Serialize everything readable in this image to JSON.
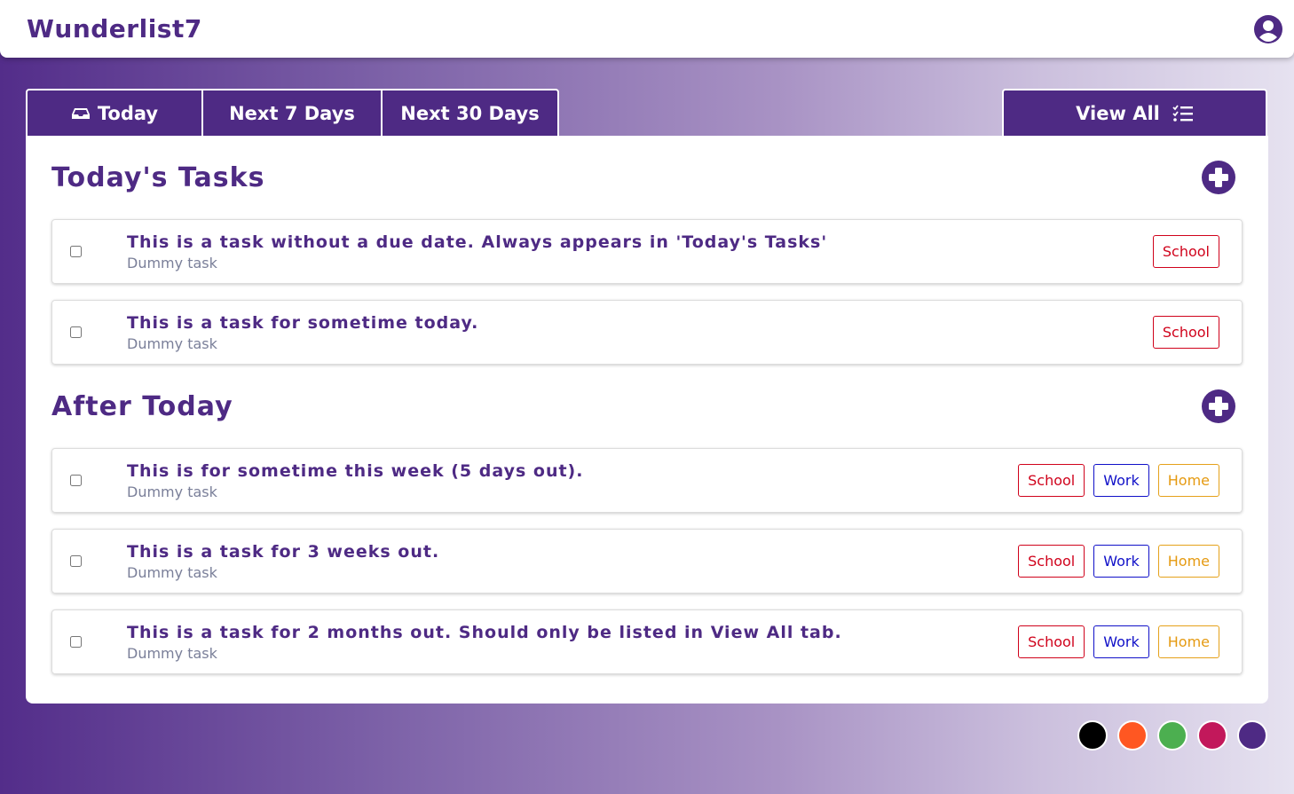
{
  "app": {
    "title": "Wunderlist7"
  },
  "tabs": {
    "today": "Today",
    "next7": "Next 7 Days",
    "next30": "Next 30 Days",
    "view_all": "View All"
  },
  "sections": [
    {
      "title": "Today's Tasks",
      "tasks": [
        {
          "title": "This is a task without a due date. Always appears in 'Today's Tasks'",
          "desc": "Dummy task",
          "checked": false,
          "tags": [
            "School"
          ]
        },
        {
          "title": "This is a task for sometime today.",
          "desc": "Dummy task",
          "checked": false,
          "tags": [
            "School"
          ]
        }
      ]
    },
    {
      "title": "After Today",
      "tasks": [
        {
          "title": "This is for sometime this week (5 days out).",
          "desc": "Dummy task",
          "checked": false,
          "tags": [
            "School",
            "Work",
            "Home"
          ]
        },
        {
          "title": "This is a task for 3 weeks out.",
          "desc": "Dummy task",
          "checked": false,
          "tags": [
            "School",
            "Work",
            "Home"
          ]
        },
        {
          "title": "This is a task for 2 months out. Should only be listed in View All tab.",
          "desc": "Dummy task",
          "checked": false,
          "tags": [
            "School",
            "Work",
            "Home"
          ]
        }
      ]
    }
  ],
  "tag_colors": {
    "School": "#d0021b",
    "Work": "#1010c8",
    "Home": "#e59a11"
  },
  "theme": {
    "accent": "#4e2a84",
    "swatches": [
      "#000000",
      "#ff5722",
      "#4caf50",
      "#c2185b",
      "#4e2a84"
    ]
  },
  "icons": {
    "user": "user-circle-icon",
    "today": "inbox-icon",
    "view_all": "checklist-icon",
    "add": "plus-circle-icon"
  }
}
